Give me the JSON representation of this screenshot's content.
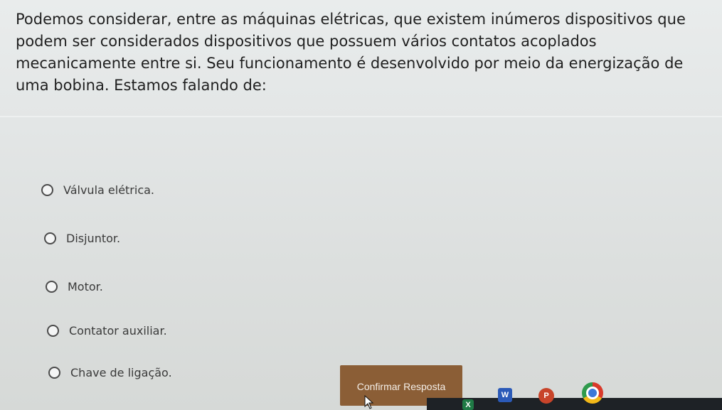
{
  "question": {
    "text": "Podemos considerar, entre as máquinas elétricas, que existem inúmeros dispositivos que podem ser considerados dispositivos que possuem vários contatos acoplados mecanicamente entre si. Seu funcionamento é desenvolvido por meio da energização de uma bobina. Estamos falando de:"
  },
  "options": [
    {
      "label": "Válvula elétrica."
    },
    {
      "label": "Disjuntor."
    },
    {
      "label": "Motor."
    },
    {
      "label": "Contator auxiliar."
    },
    {
      "label": "Chave de ligação."
    }
  ],
  "confirm_button": {
    "label": "Confirmar Resposta"
  },
  "taskbar": {
    "icons": [
      "excel-icon",
      "word-icon",
      "powerpoint-icon",
      "chrome-icon"
    ],
    "excel_letter": "X",
    "word_letter": "W",
    "powerpoint_letter": "P"
  },
  "colors": {
    "background": "#e3e6e6",
    "confirm_button": "#8b5e36",
    "question_text": "#1f1f1f"
  }
}
